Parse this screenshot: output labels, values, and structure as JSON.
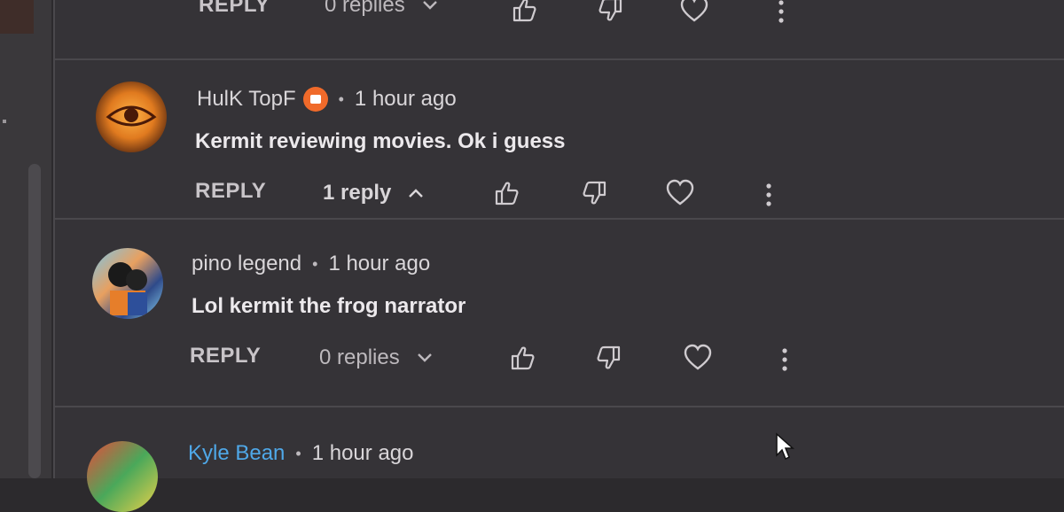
{
  "comments": [
    {
      "author": "",
      "time": "",
      "text": "",
      "reply_label": "REPLY",
      "replies_label": "0 replies",
      "replies_open": false
    },
    {
      "author": "HulK TopF",
      "has_badge": true,
      "time": "1 hour ago",
      "text": "Kermit reviewing movies. Ok i guess",
      "reply_label": "REPLY",
      "replies_label": "1 reply",
      "replies_open": true
    },
    {
      "author": "pino legend",
      "time": "1 hour ago",
      "text": "Lol kermit the frog narrator",
      "reply_label": "REPLY",
      "replies_label": "0 replies",
      "replies_open": false
    },
    {
      "author": "Kyle Bean",
      "time": "1 hour ago",
      "text": ""
    }
  ],
  "separator_dot": "•",
  "icons": [
    "like-icon",
    "dislike-icon",
    "heart-icon",
    "more-options-icon",
    "chevron-down-icon",
    "chevron-up-icon",
    "mouse-cursor-icon"
  ],
  "colors": {
    "background": "#353337",
    "link_author": "#4fa8e8",
    "badge": "#f06a2a"
  }
}
